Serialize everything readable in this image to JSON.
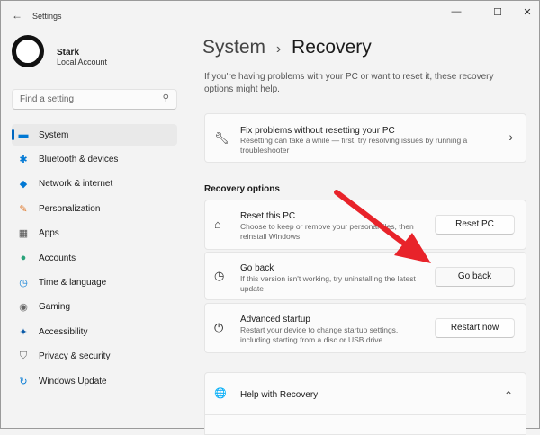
{
  "window": {
    "title": "Settings",
    "back": "←",
    "minimize": "—",
    "maximize": "☐",
    "close": "✕"
  },
  "user": {
    "name": "Stark",
    "account": "Local Account"
  },
  "search": {
    "placeholder": "Find a setting",
    "icon": "⚲"
  },
  "sidebar": {
    "items": [
      {
        "label": "System",
        "icon": "▬",
        "color": "#0078d4"
      },
      {
        "label": "Bluetooth & devices",
        "icon": "✱",
        "color": "#0078d4"
      },
      {
        "label": "Network & internet",
        "icon": "◆",
        "color": "#0078d4"
      },
      {
        "label": "Personalization",
        "icon": "✎",
        "color": "#e07a2e"
      },
      {
        "label": "Apps",
        "icon": "▦",
        "color": "#555"
      },
      {
        "label": "Accounts",
        "icon": "●",
        "color": "#2aa37a"
      },
      {
        "label": "Time & language",
        "icon": "◷",
        "color": "#0078d4"
      },
      {
        "label": "Gaming",
        "icon": "◉",
        "color": "#666"
      },
      {
        "label": "Accessibility",
        "icon": "✦",
        "color": "#0a5aa8"
      },
      {
        "label": "Privacy & security",
        "icon": "⛉",
        "color": "#666"
      },
      {
        "label": "Windows Update",
        "icon": "↻",
        "color": "#0078d4"
      }
    ]
  },
  "header": {
    "section": "System",
    "separator": "›",
    "page": "Recovery"
  },
  "intro": "If you're having problems with your PC or want to reset it, these recovery options might help.",
  "fix": {
    "title": "Fix problems without resetting your PC",
    "desc": "Resetting can take a while — first, try resolving issues by running a troubleshooter",
    "chevron": "›"
  },
  "recovery_options": {
    "heading": "Recovery options",
    "items": [
      {
        "title": "Reset this PC",
        "desc": "Choose to keep or remove your personal files, then reinstall Windows",
        "button": "Reset PC",
        "icon": "⌂"
      },
      {
        "title": "Go back",
        "desc": "If this version isn't working, try uninstalling the latest update",
        "button": "Go back",
        "icon": "◷"
      },
      {
        "title": "Advanced startup",
        "desc": "Restart your device to change startup settings, including starting from a disc or USB drive",
        "button": "Restart now",
        "icon": "⏻"
      }
    ]
  },
  "help": {
    "title": "Help with Recovery",
    "icon": "🌐",
    "chevron": "⌃"
  },
  "annotation": {
    "arrow_color": "#e8232a"
  }
}
